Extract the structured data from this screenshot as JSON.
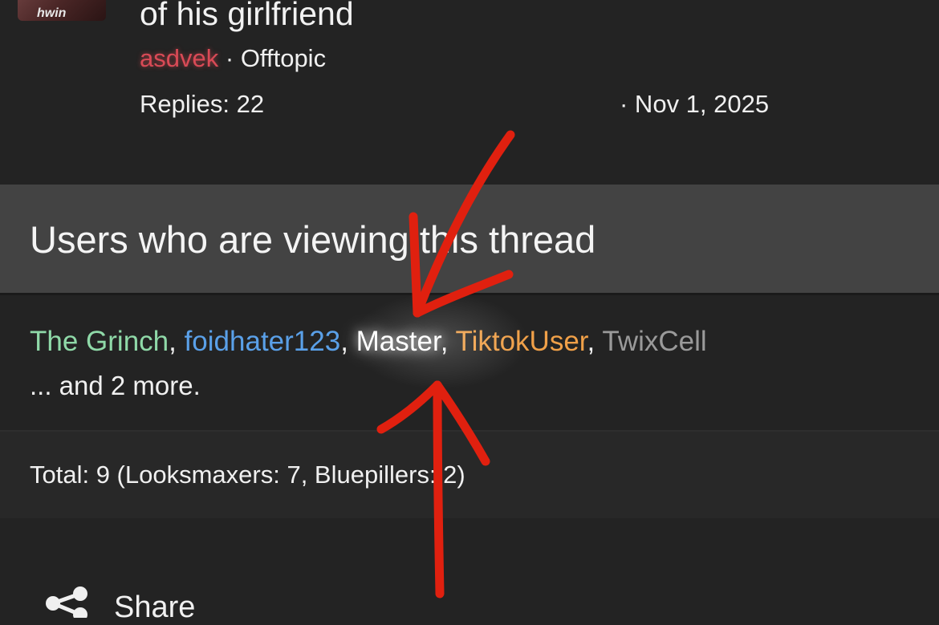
{
  "thread": {
    "title": "of his girlfriend",
    "author": "asdvek",
    "separator": "·",
    "forum": "Offtopic",
    "replies": "Replies: 22",
    "date": "· Nov 1, 2025",
    "avatar_text": "hwin"
  },
  "viewers": {
    "title": "Users who are viewing this thread",
    "users": [
      {
        "name": "The Grinch",
        "color": "#8fd9a8"
      },
      {
        "name": "foidhater123",
        "color": "#5aa0e8"
      },
      {
        "name": "Master",
        "color": "#ffffff"
      },
      {
        "name": "TiktokUser",
        "color": "#f0a048"
      },
      {
        "name": "TwixCell",
        "color": "#9a9a9a"
      }
    ],
    "sep": ", ",
    "more": "... and 2 more.",
    "total": "Total: 9 (Looksmaxers: 7, Bluepillers: 2)"
  },
  "share": {
    "label": "Share",
    "icon": "share-icon"
  },
  "colors": {
    "background": "#232323",
    "header_band": "#434343",
    "author": "#d94a56",
    "annotation_arrows": "#e0200f"
  }
}
